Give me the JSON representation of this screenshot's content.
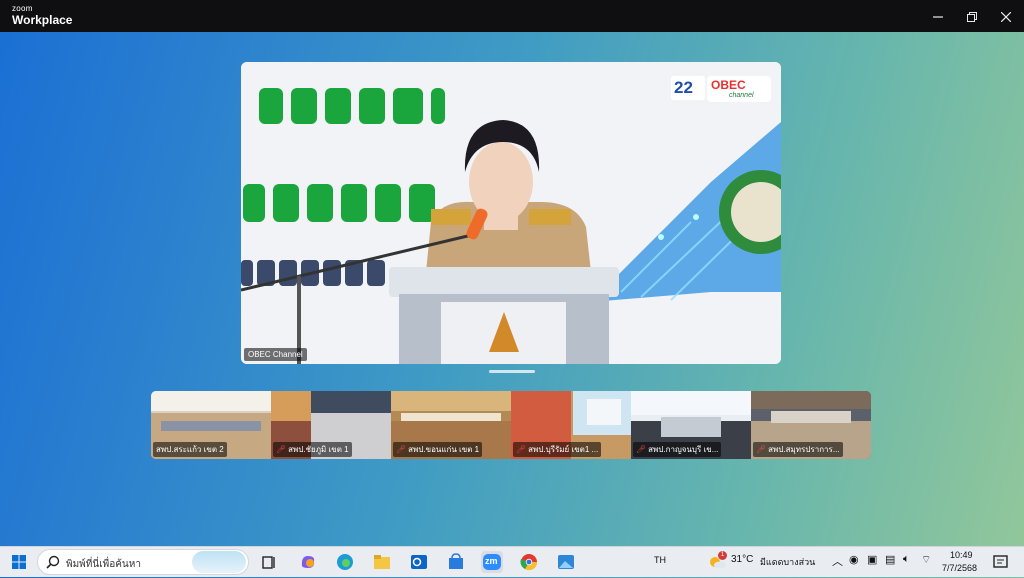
{
  "window": {
    "brand_small": "zoom",
    "brand_main": "Workplace"
  },
  "main_video": {
    "participant": "OBEC Channel",
    "badge_number": "22",
    "badge_text": "OBEC",
    "badge_sub": "channel"
  },
  "participants": [
    {
      "label": "สพป.สระแก้ว เขต 2",
      "muted": false
    },
    {
      "label": "สพป.ชัยภูมิ เขต 1",
      "muted": true
    },
    {
      "label": "สพป.ขอนแก่น เขต 1",
      "muted": true
    },
    {
      "label": "สพป.บุรีรัมย์ เขต1 ...",
      "muted": true
    },
    {
      "label": "สพป.กาญจนบุรี เข...",
      "muted": true
    },
    {
      "label": "สพป.สมุทรปราการ...",
      "muted": true
    }
  ],
  "taskbar": {
    "search_placeholder": "พิมพ์ที่นี่เพื่อค้นหา",
    "zoom_icon_text": "zm",
    "language": "TH",
    "weather_temp": "31°C",
    "weather_desc": "มีแดดบางส่วน",
    "weather_badge": "1",
    "time": "10:49",
    "date": "7/7/2568"
  }
}
